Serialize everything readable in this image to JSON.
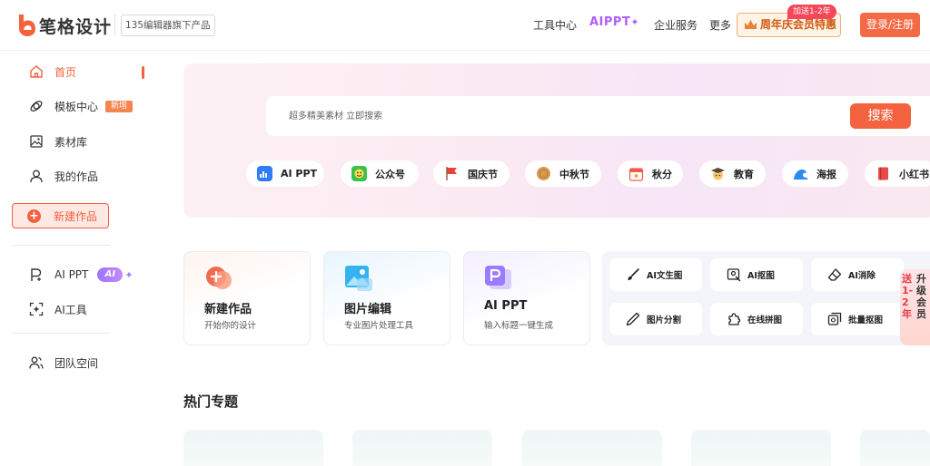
{
  "header": {
    "logo_text": "笔格设计",
    "logo_tag": "135编辑器旗下产品",
    "nav": {
      "tools": "工具中心",
      "aippt": "AIPPT",
      "enterprise": "企业服务",
      "more": "更多"
    },
    "vip_label": "周年庆会员特惠",
    "vip_badge": "加送1-2年",
    "login_label": "登录/注册"
  },
  "sidebar": {
    "items": [
      {
        "label": "首页",
        "icon": "home-icon",
        "active": true
      },
      {
        "label": "模板中心",
        "icon": "template-icon",
        "badge": "新增"
      },
      {
        "label": "素材库",
        "icon": "image-icon"
      },
      {
        "label": "我的作品",
        "icon": "user-icon"
      }
    ],
    "new_work_label": "新建作品",
    "ai_items": [
      {
        "label": "AI PPT",
        "icon": "ppt-p-icon",
        "badge": "AI"
      },
      {
        "label": "AI工具",
        "icon": "ai-tool-icon"
      }
    ],
    "team_label": "团队空间"
  },
  "search": {
    "placeholder": "超多精美素材 立即搜索",
    "button_label": "搜索"
  },
  "categories": [
    {
      "label": "AI PPT",
      "icon": "ppt-icon",
      "color": "#2f7cf6"
    },
    {
      "label": "公众号",
      "icon": "wechat-icon",
      "color": "#3cc24a"
    },
    {
      "label": "国庆节",
      "icon": "flag-icon",
      "color": "#e8423c"
    },
    {
      "label": "中秋节",
      "icon": "mooncake-icon",
      "color": "#c9843f"
    },
    {
      "label": "秋分",
      "icon": "calendar-icon",
      "color": "#ef5b4a"
    },
    {
      "label": "教育",
      "icon": "graduation-icon",
      "color": "#f2a33a"
    },
    {
      "label": "海报",
      "icon": "wave-icon",
      "color": "#2a8cf0"
    },
    {
      "label": "小红书",
      "icon": "book-icon",
      "color": "#e84848"
    }
  ],
  "cards": [
    {
      "title": "新建作品",
      "subtitle": "开始你的设计",
      "icon": "create-icon"
    },
    {
      "title": "图片编辑",
      "subtitle": "专业图片处理工具",
      "icon": "photo-edit-icon"
    },
    {
      "title": "AI PPT",
      "subtitle": "输入标题一键生成",
      "icon": "ai-ppt-icon"
    }
  ],
  "tools": [
    {
      "label": "AI文生图",
      "icon": "brush-icon"
    },
    {
      "label": "AI抠图",
      "icon": "cutout-icon"
    },
    {
      "label": "AI消除",
      "icon": "eraser-icon"
    },
    {
      "label": "图片分割",
      "icon": "pen-icon"
    },
    {
      "label": "在线拼图",
      "icon": "puzzle-icon"
    },
    {
      "label": "批量抠图",
      "icon": "batch-cutout-icon"
    }
  ],
  "promo": {
    "line1": "送1-2年",
    "line2": "升级会员"
  },
  "hot_section_title": "热门专题"
}
